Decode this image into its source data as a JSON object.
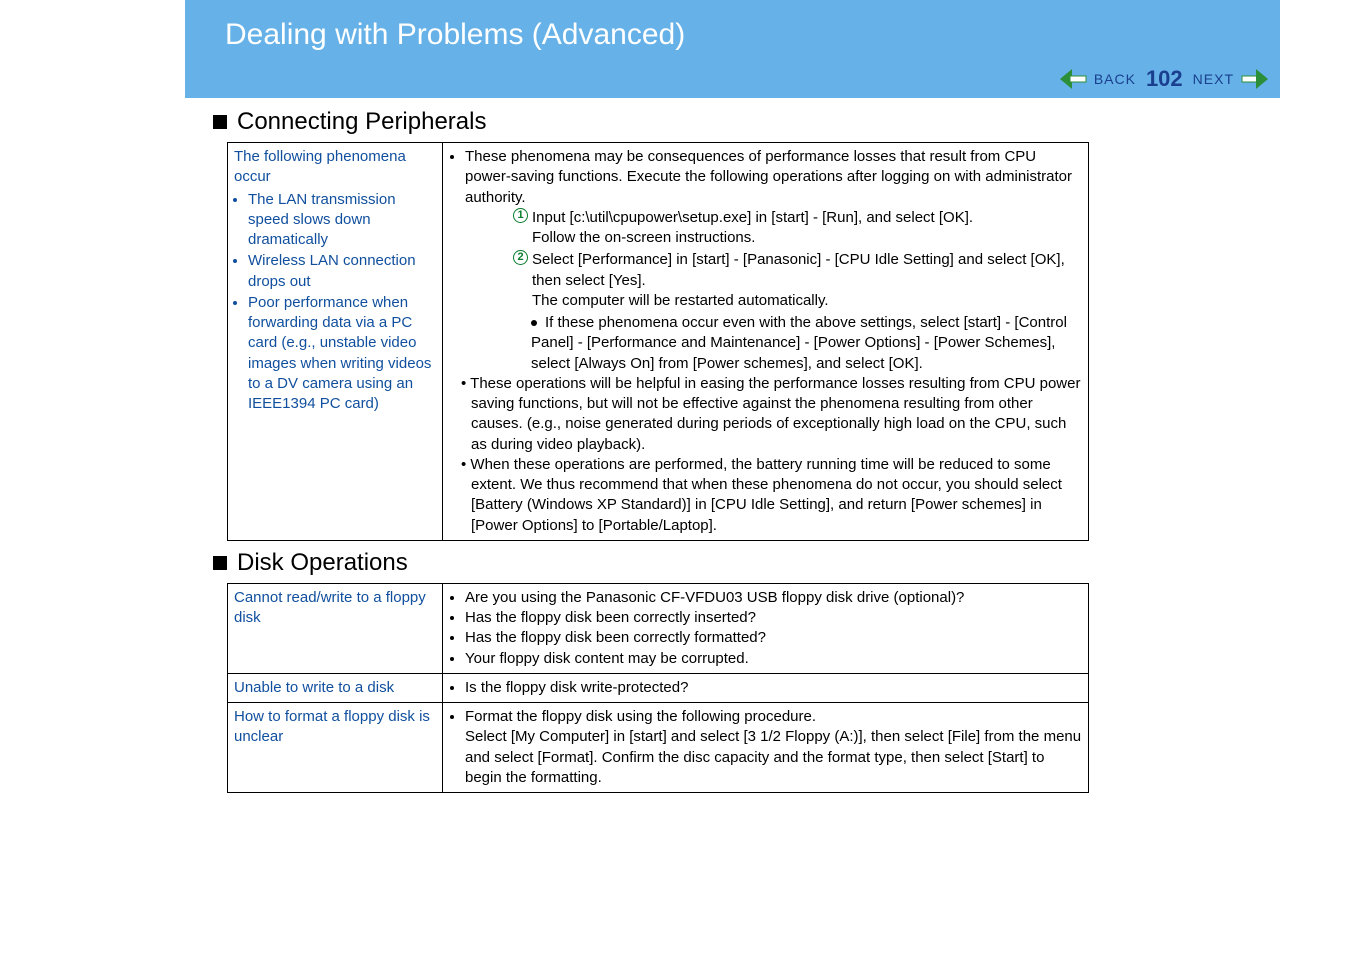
{
  "header": {
    "title": "Dealing with Problems (Advanced)",
    "back_label": "BACK",
    "page_number": "102",
    "next_label": "NEXT"
  },
  "section1": {
    "title": "Connecting Peripherals",
    "row": {
      "left_intro": "The following phenomena occur",
      "left_items": [
        "The LAN transmission speed slows down dramatically",
        "Wireless LAN connection drops out",
        "Poor performance when forwarding data via a PC card (e.g., unstable video images when writing videos to a DV camera using an IEEE1394 PC card)"
      ],
      "right_intro": "These phenomena may be consequences of performance losses that result from CPU power-saving functions. Execute the following operations after logging on with administrator authority.",
      "step1a": "Input [c:\\util\\cpupower\\setup.exe] in [start] - [Run], and select [OK].",
      "step1b": "Follow the on-screen instructions.",
      "step2a": "Select [Performance] in [start] - [Panasonic] - [CPU Idle Setting] and select [OK], then select [Yes].",
      "step2b": "The computer will be restarted automatically.",
      "sub_bullet": "If these phenomena occur even with the above settings, select [start] - [Control Panel] - [Performance and Maintenance] - [Power Options] - [Power Schemes], select [Always On] from [Power schemes], and select [OK].",
      "note1": "These operations will be helpful in easing the performance losses resulting from CPU power saving functions, but will not be effective against the phenomena resulting from other causes. (e.g., noise generated during periods of exceptionally high load on the CPU, such as during video playback).",
      "note2": "When these operations are performed, the battery running time will be reduced to some extent. We thus recommend that when these phenomena do not occur, you should select [Battery (Windows XP Standard)] in [CPU Idle Setting], and return [Power schemes] in [Power Options] to [Portable/Laptop]."
    }
  },
  "section2": {
    "title": "Disk Operations",
    "rows": [
      {
        "left": "Cannot read/write to a floppy disk",
        "right_items": [
          "Are you using the Panasonic CF-VFDU03 USB floppy disk drive (optional)?",
          "Has the floppy disk been correctly inserted?",
          "Has the floppy disk been correctly formatted?",
          "Your floppy disk content may be corrupted."
        ]
      },
      {
        "left": "Unable to write to a disk",
        "right_items": [
          "Is the floppy disk write-protected?"
        ]
      },
      {
        "left": "How to format a floppy disk is unclear",
        "right_lead": "Format the floppy disk using the following procedure.",
        "right_body": "Select [My Computer] in [start] and select [3 1/2 Floppy (A:)], then select [File] from the menu and select [Format]. Confirm the disc capacity and the format type, then select [Start] to begin the formatting."
      }
    ]
  }
}
